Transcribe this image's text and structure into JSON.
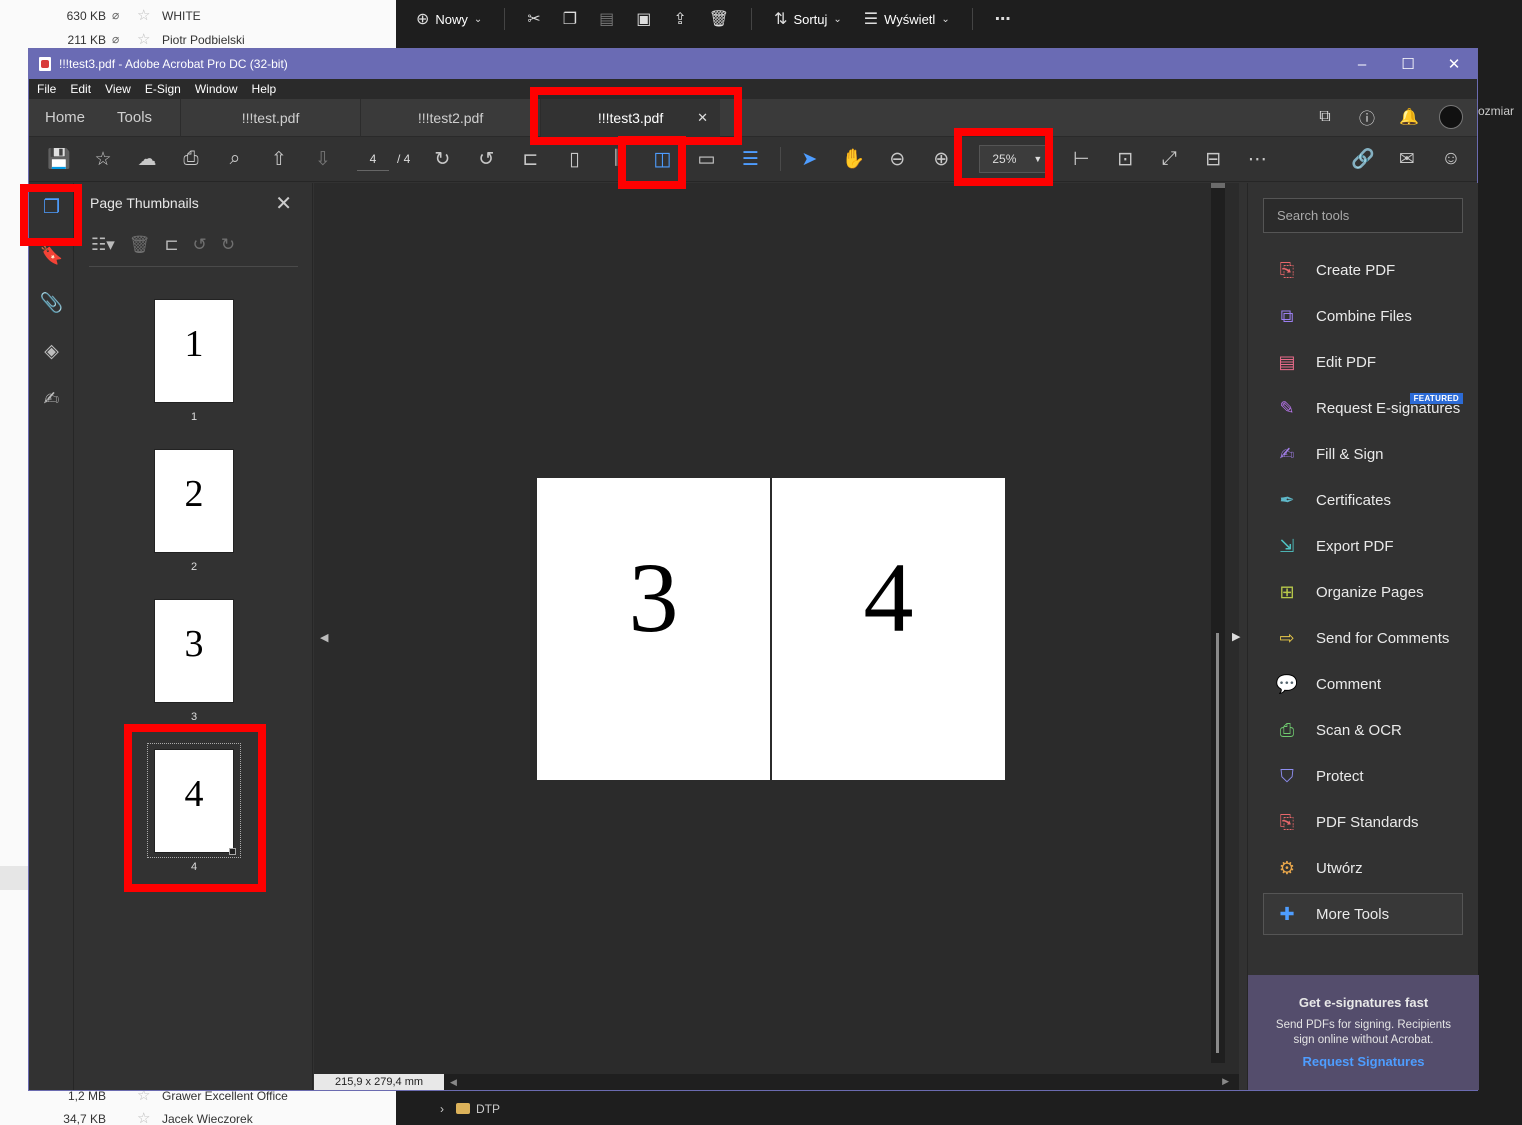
{
  "bg_explorer": {
    "rows_top": [
      {
        "size": "630 KB",
        "name": "WHITE"
      },
      {
        "size": "211 KB",
        "name": "Piotr Podbielski"
      }
    ],
    "rows_bottom": [
      {
        "size": "1,2 MB",
        "name": "Grawer Excellent Office"
      },
      {
        "size": "34,7 KB",
        "name": "Jacek Wieczorek"
      }
    ],
    "toolbar": {
      "new_label": "Nowy",
      "sort_label": "Sortuj",
      "view_label": "Wyświetl",
      "more": "⋯"
    },
    "column_tail": "ozmiar",
    "folder_name": "DTP"
  },
  "window": {
    "title": "!!!test3.pdf - Adobe Acrobat Pro DC (32-bit)",
    "menu": [
      "File",
      "Edit",
      "View",
      "E-Sign",
      "Window",
      "Help"
    ],
    "nav": {
      "home": "Home",
      "tools": "Tools"
    },
    "tabs": [
      "!!!test.pdf",
      "!!!test2.pdf",
      "!!!test3.pdf"
    ],
    "active_tab": 2
  },
  "toolbar": {
    "current_page": "4",
    "total_pages": "/ 4",
    "zoom": "25%"
  },
  "thumbnails": {
    "title": "Page Thumbnails",
    "pages": [
      {
        "number": "1",
        "label": "1"
      },
      {
        "number": "2",
        "label": "2"
      },
      {
        "number": "3",
        "label": "3"
      },
      {
        "number": "4",
        "label": "4"
      }
    ],
    "selected_page": 4
  },
  "document": {
    "visible_pages": [
      "3",
      "4"
    ],
    "page_size": "215,9 x 279,4 mm"
  },
  "tools_pane": {
    "search_placeholder": "Search tools",
    "items": [
      {
        "label": "Create PDF",
        "icon": "create-pdf-icon",
        "color": "#e8676b"
      },
      {
        "label": "Combine Files",
        "icon": "combine-files-icon",
        "color": "#9b7ef0"
      },
      {
        "label": "Edit PDF",
        "icon": "edit-pdf-icon",
        "color": "#e86b8a"
      },
      {
        "label": "Request E-signatures",
        "icon": "request-esign-icon",
        "color": "#b574e8",
        "badge": "FEATURED"
      },
      {
        "label": "Fill & Sign",
        "icon": "fill-sign-icon",
        "color": "#a17ee8"
      },
      {
        "label": "Certificates",
        "icon": "certificates-icon",
        "color": "#5fb8c9"
      },
      {
        "label": "Export PDF",
        "icon": "export-pdf-icon",
        "color": "#4fc2c2"
      },
      {
        "label": "Organize Pages",
        "icon": "organize-pages-icon",
        "color": "#b8c94a"
      },
      {
        "label": "Send for Comments",
        "icon": "send-comments-icon",
        "color": "#e8c94a"
      },
      {
        "label": "Comment",
        "icon": "comment-icon",
        "color": "#e8c94a"
      },
      {
        "label": "Scan & OCR",
        "icon": "scan-ocr-icon",
        "color": "#6fc96f"
      },
      {
        "label": "Protect",
        "icon": "protect-icon",
        "color": "#8e8ef0"
      },
      {
        "label": "PDF Standards",
        "icon": "pdf-standards-icon",
        "color": "#e8676b"
      },
      {
        "label": "Utwórz",
        "icon": "utworz-icon",
        "color": "#e8a64a"
      },
      {
        "label": "More Tools",
        "icon": "more-tools-icon",
        "color": "#4e9dff"
      }
    ],
    "promo": {
      "title": "Get e-signatures fast",
      "body": "Send PDFs for signing. Recipients sign online without Acrobat.",
      "link": "Request Signatures"
    }
  },
  "colors": {
    "accent": "#4e9dff",
    "titlebar": "#6a6bb4",
    "highlight": "#ff0000"
  }
}
